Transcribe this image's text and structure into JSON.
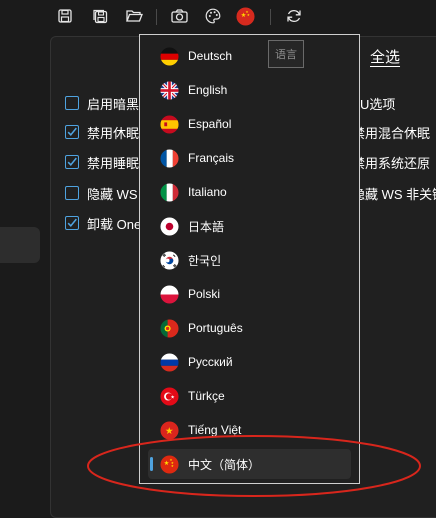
{
  "toolbar": {
    "items": [
      "save-icon",
      "save-as-icon",
      "open-folder-icon",
      "camera-icon",
      "palette-icon",
      "language-flag-icon",
      "refresh-icon"
    ]
  },
  "options": {
    "left": [
      {
        "label": "启用暗黑",
        "checked": false
      },
      {
        "label": "禁用休眠",
        "checked": true
      },
      {
        "label": "禁用睡眠",
        "checked": true
      },
      {
        "label": "隐藏 WS",
        "checked": false
      },
      {
        "label": "卸载 One",
        "checked": true
      }
    ],
    "right": [
      "U选项",
      "禁用混合休眠",
      "禁用系统还原",
      "隐藏 WS 非关键"
    ]
  },
  "select_all": "全选",
  "language_menu": {
    "tooltip": "语言",
    "selected_index": 13,
    "items": [
      {
        "label": "Deutsch",
        "flag": "de"
      },
      {
        "label": "English",
        "flag": "gb"
      },
      {
        "label": "Español",
        "flag": "es"
      },
      {
        "label": "Français",
        "flag": "fr"
      },
      {
        "label": "Italiano",
        "flag": "it"
      },
      {
        "label": "日本語",
        "flag": "jp"
      },
      {
        "label": "한국인",
        "flag": "kr"
      },
      {
        "label": "Polski",
        "flag": "pl"
      },
      {
        "label": "Português",
        "flag": "pt"
      },
      {
        "label": "Русский",
        "flag": "ru"
      },
      {
        "label": "Türkçe",
        "flag": "tr"
      },
      {
        "label": "Tiếng Việt",
        "flag": "vn"
      },
      {
        "label": "中文（简体）",
        "flag": "cn"
      }
    ]
  },
  "colors": {
    "accent": "#4fa3e0",
    "annotation": "#d8261c"
  }
}
